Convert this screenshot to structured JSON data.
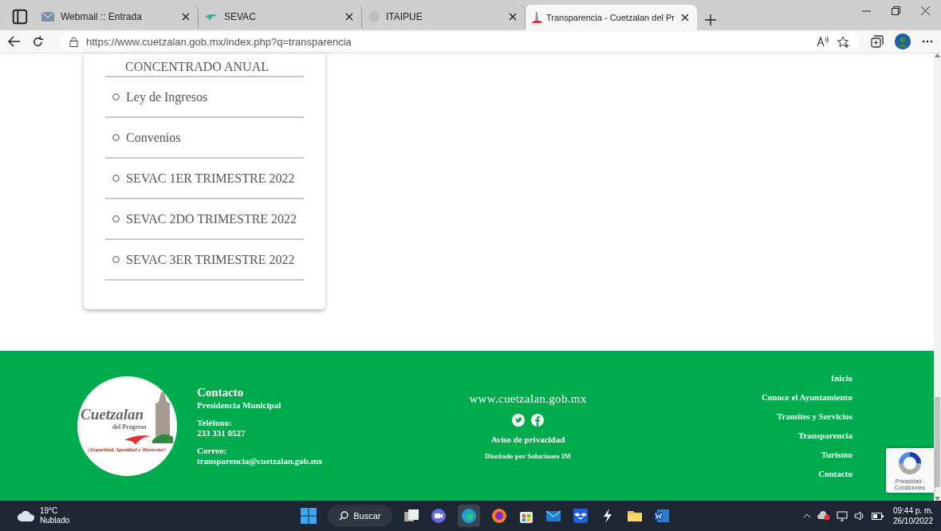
{
  "browser": {
    "tabs": [
      {
        "title": "Webmail :: Entrada",
        "selected": false,
        "kind": "mail"
      },
      {
        "title": "SEVAC",
        "selected": false,
        "kind": "bird"
      },
      {
        "title": "ITAIPUE",
        "selected": false,
        "kind": "grey"
      },
      {
        "title": "Transparencia - Cuetzalan del Pr",
        "selected": true,
        "kind": "tower"
      }
    ],
    "url": "https://www.cuetzalan.gob.mx/index.php?q=transparencia"
  },
  "menu_card": {
    "items": [
      {
        "label": "CONCENTRADO ANUAL",
        "kind": "plain"
      },
      {
        "label": "Ley de Ingresos",
        "kind": "bullet"
      },
      {
        "label": "Convenios",
        "kind": "bullet"
      },
      {
        "label": "SEVAC 1ER TRIMESTRE 2022",
        "kind": "bullet"
      },
      {
        "label": "SEVAC 2DO TRIMESTRE 2022",
        "kind": "bullet"
      },
      {
        "label": "SEVAC 3ER TRIMESTRE 2022",
        "kind": "bullet"
      }
    ]
  },
  "footer": {
    "logo": {
      "name": "Cuetzalan",
      "subtitle": "del Progreso",
      "slogan": "¡Seguridad, Igualdad y Bienestar!"
    },
    "contact": {
      "heading": "Contacto",
      "office": "Presidencia Municipal",
      "phone_label": "Teléfono:",
      "phone": "233 331 0527",
      "email_label": "Correo:",
      "email": "transparencia@cuetzalan.gob.mx"
    },
    "website": "www.cuetzalan.gob.mx",
    "privacy_link": "Aviso de privacidad",
    "credit": "Diseñado por Soluciones IM",
    "nav_links": [
      "Inicio",
      "Conoce el Ayuntamiento",
      "Tramites y Servicios",
      "Transparencia",
      "Turismo",
      "Contacto"
    ]
  },
  "recaptcha": {
    "text": "Privacidad - Condiciones"
  },
  "taskbar": {
    "weather": {
      "temp": "19°C",
      "condition": "Nublado"
    },
    "search": "Buscar",
    "time": "09:44 p. m.",
    "date": "26/10/2022"
  }
}
